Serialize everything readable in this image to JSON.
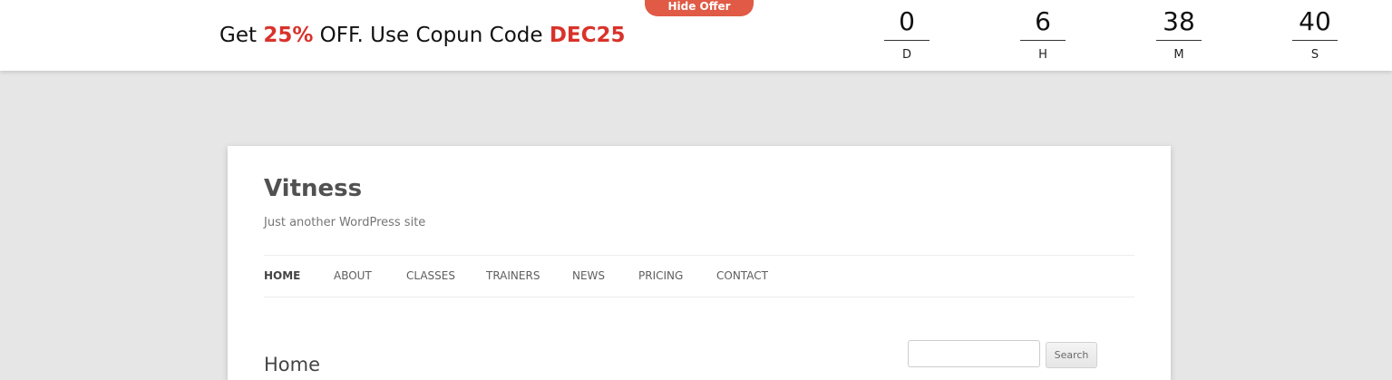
{
  "offer_bar": {
    "hide_label": "Hide Offer",
    "text_prefix": "Get ",
    "percent": "25%",
    "text_middle": " OFF. Use Copun Code ",
    "code": "DEC25",
    "accent_color": "#d8332b",
    "button_color": "#e05a45"
  },
  "countdown": [
    {
      "value": "0",
      "label": "D"
    },
    {
      "value": "6",
      "label": "H"
    },
    {
      "value": "38",
      "label": "M"
    },
    {
      "value": "40",
      "label": "S"
    }
  ],
  "site": {
    "title": "Vitness",
    "tagline": "Just another WordPress site"
  },
  "nav": {
    "items": [
      {
        "label": "HOME",
        "current": true
      },
      {
        "label": "ABOUT"
      },
      {
        "label": "CLASSES"
      },
      {
        "label": "TRAINERS"
      },
      {
        "label": "NEWS"
      },
      {
        "label": "PRICING"
      },
      {
        "label": "CONTACT"
      }
    ]
  },
  "main": {
    "heading": "Home"
  },
  "search": {
    "value": "",
    "button_label": "Search"
  }
}
